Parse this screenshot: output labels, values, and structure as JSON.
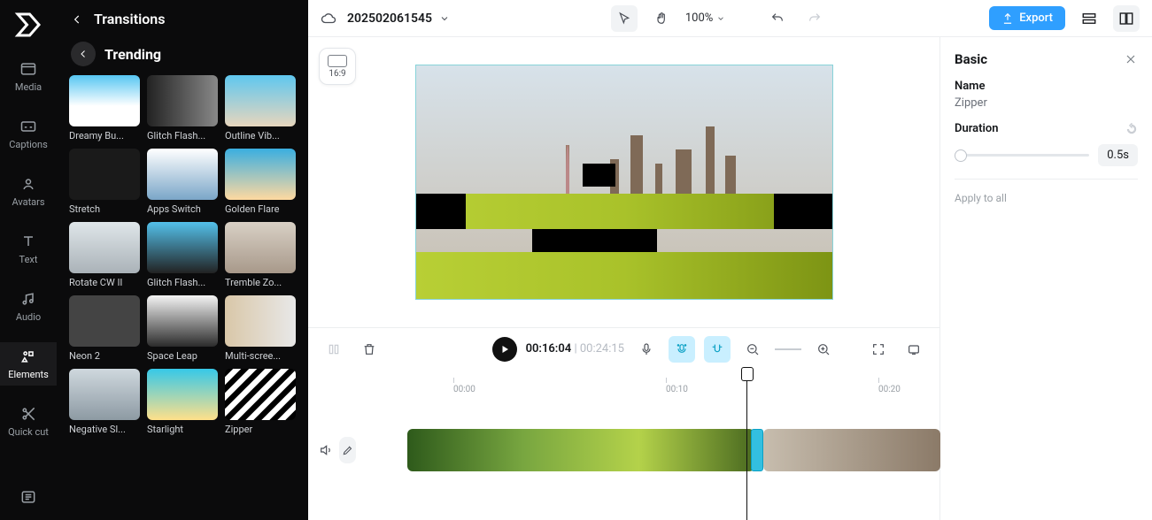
{
  "nav": {
    "items": [
      {
        "label": "Media"
      },
      {
        "label": "Captions"
      },
      {
        "label": "Avatars"
      },
      {
        "label": "Text"
      },
      {
        "label": "Audio"
      },
      {
        "label": "Elements"
      },
      {
        "label": "Quick cut"
      }
    ]
  },
  "panel": {
    "title": "Transitions",
    "category": "Trending",
    "thumbs": [
      {
        "label": "Dreamy Bu..."
      },
      {
        "label": "Glitch Flash..."
      },
      {
        "label": "Outline Vib..."
      },
      {
        "label": "Stretch"
      },
      {
        "label": "Apps Switch"
      },
      {
        "label": "Golden Flare"
      },
      {
        "label": "Rotate CW II"
      },
      {
        "label": "Glitch Flash..."
      },
      {
        "label": "Tremble Zo..."
      },
      {
        "label": "Neon 2"
      },
      {
        "label": "Space Leap"
      },
      {
        "label": "Multi-scree..."
      },
      {
        "label": "Negative Sl..."
      },
      {
        "label": "Starlight"
      },
      {
        "label": "Zipper"
      }
    ]
  },
  "header": {
    "project_title": "202502061545",
    "zoom": "100%",
    "export_label": "Export"
  },
  "preview": {
    "ratio": "16:9"
  },
  "playback": {
    "current": "00:16:04",
    "total": "00:24:15"
  },
  "ruler": {
    "marks": [
      "00:00",
      "00:10",
      "00:20"
    ]
  },
  "props": {
    "section": "Basic",
    "name_label": "Name",
    "name_value": "Zipper",
    "duration_label": "Duration",
    "duration_value": "0.5s",
    "apply_label": "Apply to all"
  }
}
